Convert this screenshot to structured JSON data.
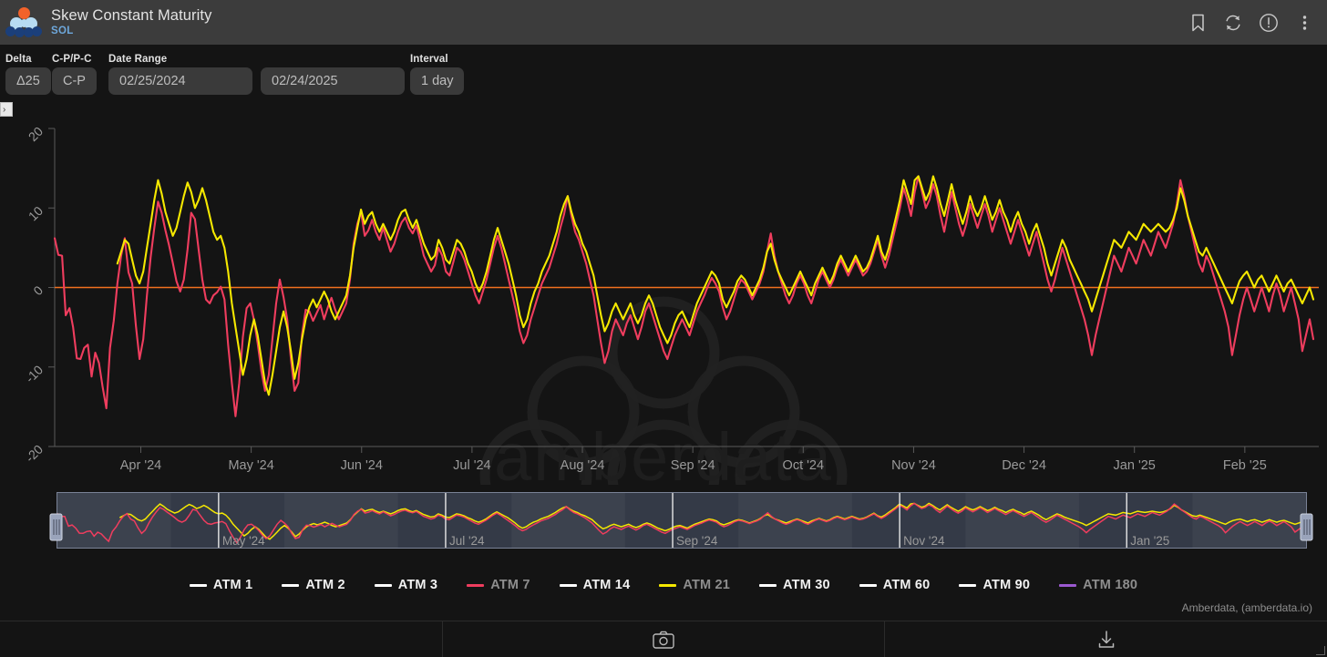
{
  "titlebar": {
    "logo_name": "amberdata-logo",
    "title": "Skew Constant Maturity",
    "subtitle": "SOL",
    "icons": [
      {
        "name": "bookmark-icon",
        "label": "Bookmark"
      },
      {
        "name": "refresh-icon",
        "label": "Refresh"
      },
      {
        "name": "alert-info-icon",
        "label": "Info"
      },
      {
        "name": "more-vertical-icon",
        "label": "More options"
      }
    ]
  },
  "controls": {
    "delta": {
      "label": "Delta",
      "value": "Δ25"
    },
    "cp_pc": {
      "label": "C-P/P-C",
      "value": "C-P"
    },
    "date_range": {
      "label": "Date Range",
      "start": "02/25/2024",
      "end": "02/24/2025"
    },
    "interval": {
      "label": "Interval",
      "value": "1 day"
    },
    "expander_glyph": "›"
  },
  "chart_data": {
    "type": "line",
    "title": "Skew Constant Maturity",
    "subtitle": "SOL",
    "xlabel": "",
    "ylabel": "",
    "ylim": [
      -20,
      20
    ],
    "yticks": [
      20,
      10,
      0,
      -10,
      -20
    ],
    "xticks": [
      "Apr '24",
      "May '24",
      "Jun '24",
      "Jul '24",
      "Aug '24",
      "Sep '24",
      "Oct '24",
      "Nov '24",
      "Dec '24",
      "Jan '25",
      "Feb '25"
    ],
    "x_range": [
      "02/25/2024",
      "02/24/2025"
    ],
    "grid": false,
    "legend_position": "bottom",
    "reference_line": {
      "value": 0,
      "color": "#f2701f"
    },
    "watermark": "amberdata",
    "attribution": "Amberdata, (amberdata.io)",
    "series": [
      {
        "name": "ATM 1",
        "color": "#ffffff",
        "visible": false,
        "values": []
      },
      {
        "name": "ATM 2",
        "color": "#ffffff",
        "visible": false,
        "values": []
      },
      {
        "name": "ATM 3",
        "color": "#ffffff",
        "visible": false,
        "values": []
      },
      {
        "name": "ATM 7",
        "color": "#ef3d5e",
        "visible": true,
        "values": [
          6.2,
          4.1,
          4.0,
          -3.5,
          -2.6,
          -5.0,
          -8.9,
          -9.0,
          -7.6,
          -7.2,
          -11.2,
          -8.2,
          -9.5,
          -12.5,
          -15.2,
          -7.6,
          -4.2,
          0.5,
          4.0,
          6.2,
          1.9,
          0.5,
          -4.8,
          -9.0,
          -6.5,
          -1.0,
          3.8,
          7.5,
          10.8,
          9.4,
          7.2,
          5.3,
          3.1,
          0.8,
          -0.5,
          1.0,
          4.8,
          9.4,
          8.6,
          4.8,
          1.0,
          -1.5,
          -2.0,
          -1.0,
          -0.6,
          0.1,
          -1.5,
          -7.2,
          -12.0,
          -16.2,
          -12.0,
          -6.2,
          -2.6,
          -2.0,
          -4.1,
          -7.0,
          -10.5,
          -13.0,
          -11.0,
          -6.5,
          -2.0,
          1.0,
          -1.2,
          -4.0,
          -9.0,
          -13.0,
          -12.0,
          -6.0,
          -2.8,
          -3.0,
          -4.2,
          -3.2,
          -2.2,
          -4.0,
          -2.5,
          -1.3,
          -2.8,
          -4.0,
          -3.0,
          -2.0,
          1.0,
          5.5,
          8.0,
          9.5,
          6.5,
          7.2,
          8.5,
          7.0,
          6.0,
          7.5,
          6.0,
          4.5,
          5.5,
          7.0,
          8.2,
          8.8,
          7.5,
          6.8,
          7.8,
          6.0,
          4.0,
          3.0,
          2.0,
          2.8,
          5.0,
          4.0,
          2.0,
          1.5,
          3.2,
          5.0,
          4.5,
          3.5,
          2.0,
          0.5,
          -1.0,
          -2.0,
          -0.5,
          1.0,
          3.0,
          5.0,
          6.5,
          5.0,
          3.0,
          1.0,
          -1.0,
          -3.0,
          -5.5,
          -7.0,
          -6.0,
          -4.0,
          -2.5,
          -1.0,
          0.5,
          1.5,
          2.5,
          4.0,
          5.5,
          7.5,
          9.2,
          11.5,
          9.0,
          7.0,
          6.0,
          4.5,
          3.0,
          1.0,
          -1.0,
          -4.0,
          -7.0,
          -9.5,
          -8.0,
          -5.5,
          -4.0,
          -5.0,
          -6.0,
          -4.5,
          -3.5,
          -5.0,
          -6.5,
          -5.0,
          -3.0,
          -2.0,
          -3.5,
          -5.0,
          -6.5,
          -8.0,
          -9.0,
          -7.5,
          -6.0,
          -5.0,
          -4.0,
          -5.0,
          -6.0,
          -4.5,
          -3.0,
          -2.0,
          -1.0,
          0.2,
          1.2,
          0.5,
          -0.5,
          -2.5,
          -4.0,
          -3.0,
          -1.5,
          0.0,
          1.0,
          0.5,
          -0.5,
          -1.5,
          -0.5,
          0.5,
          2.0,
          4.5,
          6.8,
          4.0,
          2.0,
          0.5,
          -1.0,
          -2.0,
          -1.0,
          0.5,
          1.5,
          0.5,
          -1.0,
          -2.0,
          -0.5,
          1.0,
          2.0,
          1.0,
          0.0,
          1.0,
          2.5,
          3.5,
          2.5,
          1.5,
          2.5,
          3.5,
          2.5,
          1.5,
          2.0,
          3.0,
          4.5,
          6.0,
          4.0,
          2.5,
          4.0,
          6.0,
          8.0,
          10.0,
          12.5,
          11.0,
          9.0,
          12.0,
          14.0,
          12.0,
          10.0,
          11.0,
          13.0,
          11.5,
          9.0,
          7.0,
          9.5,
          12.0,
          10.0,
          8.0,
          6.5,
          8.0,
          10.5,
          9.0,
          7.5,
          9.0,
          10.5,
          9.0,
          7.0,
          8.5,
          10.0,
          8.5,
          7.0,
          5.5,
          7.0,
          8.5,
          7.0,
          5.5,
          4.0,
          5.5,
          7.0,
          5.0,
          3.0,
          1.0,
          -0.5,
          1.0,
          3.0,
          5.0,
          3.5,
          2.0,
          0.5,
          -1.0,
          -2.5,
          -4.0,
          -6.0,
          -8.5,
          -6.0,
          -4.0,
          -2.0,
          0.0,
          2.0,
          4.0,
          3.0,
          2.0,
          3.5,
          5.0,
          4.0,
          3.0,
          4.5,
          6.0,
          5.0,
          4.0,
          5.5,
          7.0,
          6.0,
          5.0,
          6.5,
          8.0,
          10.5,
          13.5,
          11.5,
          9.0,
          7.0,
          5.0,
          3.0,
          2.0,
          4.0,
          3.0,
          1.5,
          0.0,
          -1.5,
          -3.0,
          -5.0,
          -8.5,
          -6.0,
          -3.5,
          -1.5,
          0.0,
          -1.5,
          -3.0,
          -1.5,
          0.0,
          -1.5,
          -3.0,
          -1.0,
          0.5,
          -1.0,
          -3.0,
          -1.5,
          0.0,
          -2.0,
          -4.0,
          -8.0,
          -6.0,
          -4.0,
          -6.5
        ]
      },
      {
        "name": "ATM 14",
        "color": "#ffffff",
        "visible": false,
        "values": []
      },
      {
        "name": "ATM 21",
        "color": "#f5e800",
        "visible": true,
        "values": [
          null,
          null,
          null,
          null,
          null,
          null,
          null,
          null,
          null,
          null,
          null,
          null,
          null,
          null,
          null,
          null,
          null,
          3.0,
          4.5,
          6.0,
          5.5,
          3.5,
          1.5,
          0.5,
          2.0,
          5.0,
          8.0,
          11.0,
          13.5,
          11.8,
          9.5,
          8.0,
          6.5,
          7.5,
          9.5,
          11.5,
          13.2,
          12.0,
          10.0,
          11.0,
          12.5,
          11.0,
          9.0,
          7.0,
          6.0,
          6.5,
          5.0,
          2.0,
          -2.0,
          -5.0,
          -8.0,
          -11.0,
          -9.0,
          -6.0,
          -4.0,
          -6.0,
          -9.0,
          -12.0,
          -13.5,
          -11.0,
          -8.0,
          -5.0,
          -3.0,
          -5.0,
          -8.0,
          -11.5,
          -9.5,
          -6.5,
          -4.0,
          -2.5,
          -1.5,
          -2.5,
          -1.5,
          -0.5,
          -1.5,
          -3.0,
          -4.0,
          -3.0,
          -2.0,
          -1.0,
          1.5,
          5.0,
          7.5,
          9.8,
          8.0,
          9.0,
          9.5,
          8.0,
          7.0,
          8.0,
          7.0,
          6.0,
          7.0,
          8.5,
          9.5,
          9.8,
          8.5,
          7.5,
          8.5,
          7.0,
          5.5,
          4.5,
          3.5,
          4.0,
          6.0,
          5.0,
          3.5,
          3.0,
          4.5,
          6.0,
          5.5,
          4.5,
          3.0,
          2.0,
          0.5,
          -0.5,
          0.5,
          2.0,
          4.0,
          6.0,
          7.5,
          6.0,
          4.5,
          3.0,
          1.0,
          -1.0,
          -3.5,
          -5.0,
          -4.0,
          -2.0,
          -0.5,
          0.5,
          2.0,
          3.0,
          4.0,
          5.5,
          7.0,
          9.0,
          10.5,
          11.5,
          9.5,
          8.0,
          7.0,
          5.5,
          4.5,
          3.0,
          1.5,
          -1.0,
          -3.5,
          -5.5,
          -4.5,
          -3.0,
          -2.0,
          -3.0,
          -4.0,
          -3.0,
          -2.0,
          -3.5,
          -4.5,
          -3.5,
          -2.0,
          -1.0,
          -2.0,
          -3.5,
          -5.0,
          -6.0,
          -7.0,
          -6.0,
          -4.5,
          -3.5,
          -3.0,
          -4.0,
          -5.0,
          -3.5,
          -2.0,
          -1.0,
          0.0,
          1.0,
          2.0,
          1.5,
          0.5,
          -1.5,
          -2.5,
          -1.5,
          -0.5,
          0.8,
          1.5,
          1.0,
          0.0,
          -1.0,
          0.0,
          1.0,
          2.5,
          4.5,
          5.5,
          3.5,
          2.0,
          1.0,
          0.0,
          -1.0,
          0.0,
          1.0,
          2.0,
          1.0,
          0.0,
          -1.0,
          0.5,
          1.5,
          2.5,
          1.5,
          0.5,
          1.5,
          3.0,
          4.0,
          3.0,
          2.0,
          3.0,
          4.0,
          3.0,
          2.0,
          2.5,
          3.5,
          5.0,
          6.5,
          4.5,
          3.5,
          5.0,
          7.0,
          9.0,
          11.0,
          13.5,
          12.0,
          10.5,
          13.5,
          14.0,
          12.5,
          11.0,
          12.0,
          14.0,
          12.5,
          10.5,
          9.0,
          11.0,
          13.0,
          11.0,
          9.5,
          8.0,
          9.5,
          11.5,
          10.0,
          9.0,
          10.0,
          11.5,
          10.0,
          8.5,
          9.5,
          11.0,
          9.5,
          8.5,
          7.0,
          8.5,
          9.5,
          8.0,
          7.0,
          5.5,
          7.0,
          8.0,
          6.5,
          5.0,
          3.0,
          1.5,
          3.0,
          4.5,
          6.0,
          5.0,
          3.5,
          2.5,
          1.5,
          0.5,
          -0.5,
          -1.5,
          -3.0,
          -1.5,
          0.0,
          1.5,
          3.0,
          4.5,
          6.0,
          5.5,
          5.0,
          6.0,
          7.0,
          6.5,
          6.0,
          7.0,
          8.0,
          7.5,
          7.0,
          7.5,
          8.0,
          7.5,
          7.0,
          7.5,
          8.5,
          10.0,
          12.5,
          11.0,
          9.0,
          7.5,
          6.0,
          4.5,
          4.0,
          5.0,
          4.0,
          3.0,
          2.0,
          1.0,
          0.0,
          -1.0,
          -2.0,
          -0.5,
          0.8,
          1.5,
          2.0,
          1.0,
          0.0,
          1.0,
          1.5,
          0.5,
          -0.5,
          0.5,
          1.5,
          0.5,
          -0.5,
          0.5,
          1.0,
          0.0,
          -1.0,
          -2.0,
          -1.0,
          0.0,
          -1.5
        ]
      },
      {
        "name": "ATM 30",
        "color": "#ffffff",
        "visible": false,
        "values": []
      },
      {
        "name": "ATM 60",
        "color": "#ffffff",
        "visible": false,
        "values": []
      },
      {
        "name": "ATM 90",
        "color": "#ffffff",
        "visible": false,
        "values": []
      },
      {
        "name": "ATM 180",
        "color": "#9b59d0",
        "visible": false,
        "values": []
      }
    ]
  },
  "legend": [
    {
      "label": "ATM 1",
      "color": "#ffffff",
      "active": false
    },
    {
      "label": "ATM 2",
      "color": "#ffffff",
      "active": false
    },
    {
      "label": "ATM 3",
      "color": "#ffffff",
      "active": false
    },
    {
      "label": "ATM 7",
      "color": "#ef3d5e",
      "active": true
    },
    {
      "label": "ATM 14",
      "color": "#ffffff",
      "active": false
    },
    {
      "label": "ATM 21",
      "color": "#f5e800",
      "active": true
    },
    {
      "label": "ATM 30",
      "color": "#ffffff",
      "active": false
    },
    {
      "label": "ATM 60",
      "color": "#ffffff",
      "active": false
    },
    {
      "label": "ATM 90",
      "color": "#ffffff",
      "active": false
    },
    {
      "label": "ATM 180",
      "color": "#9b59d0",
      "active": true
    }
  ],
  "minimap": {
    "xticks": [
      "May '24",
      "Jul '24",
      "Sep '24",
      "Nov '24",
      "Jan '25"
    ],
    "selection_start_pct": 0,
    "selection_end_pct": 100
  },
  "attribution": "Amberdata, (amberdata.io)",
  "bottombar": [
    {
      "name": "screenshot-button",
      "icon": "camera-icon"
    },
    {
      "name": "download-button",
      "icon": "download-icon"
    }
  ]
}
